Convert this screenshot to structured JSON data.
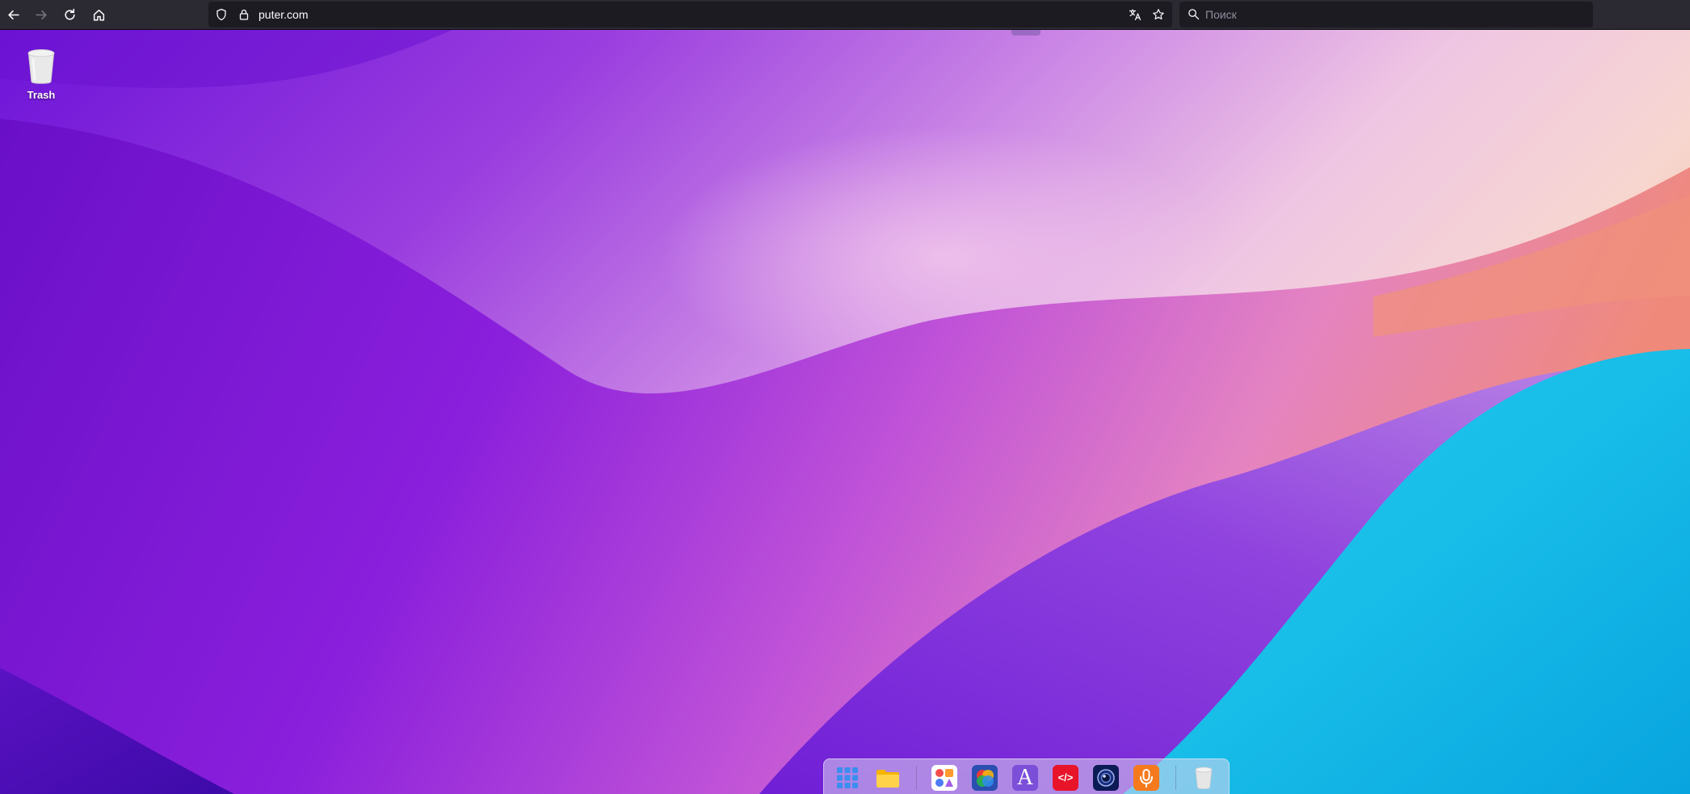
{
  "browser": {
    "url": "puter.com",
    "search_placeholder": "Поиск"
  },
  "desktop": {
    "icons": [
      {
        "label": "Trash"
      }
    ]
  },
  "dock": {
    "items": [
      {
        "icon": "app-grid-icon"
      },
      {
        "icon": "folder-icon"
      },
      {
        "icon": "app-center-icon"
      },
      {
        "icon": "paint-app-icon"
      },
      {
        "icon": "text-editor-icon"
      },
      {
        "icon": "code-editor-icon"
      },
      {
        "icon": "camera-app-icon"
      },
      {
        "icon": "recorder-app-icon"
      },
      {
        "icon": "trash-icon"
      }
    ],
    "text_editor_letter": "A",
    "code_editor_glyph": "</>"
  }
}
